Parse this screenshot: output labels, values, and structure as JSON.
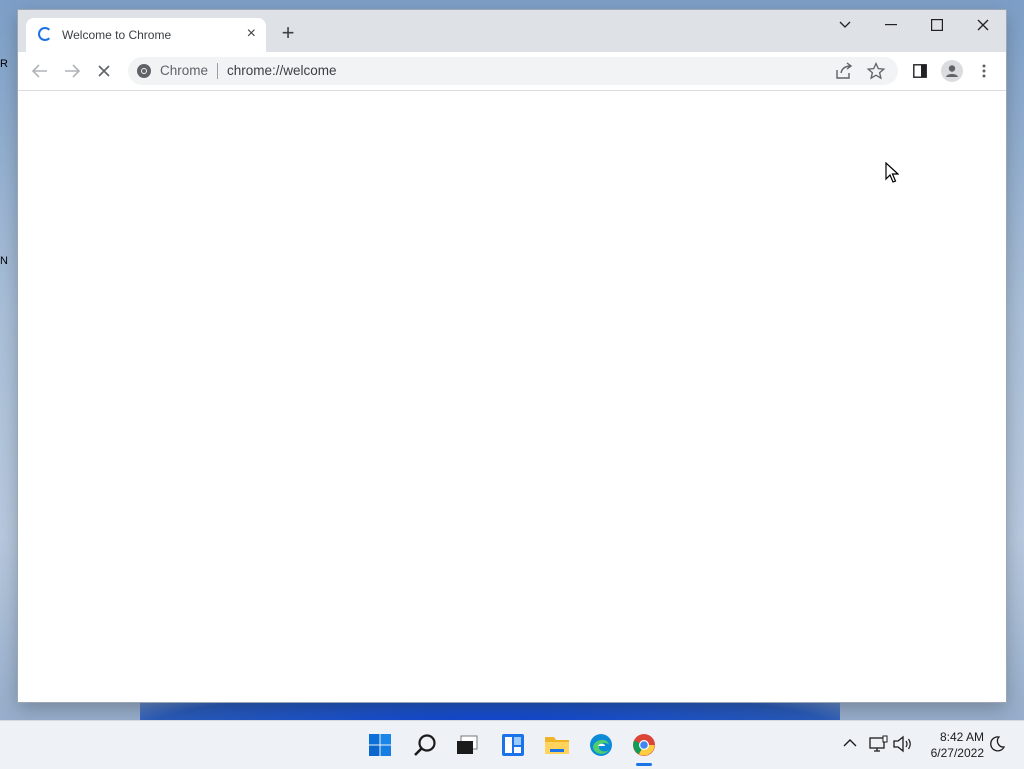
{
  "desktop": {
    "frag1": "R",
    "frag2": "N"
  },
  "browser": {
    "tab": {
      "title": "Welcome to Chrome",
      "close_label": "×"
    },
    "newtab_label": "+",
    "omnibox": {
      "chip_label": "Chrome",
      "url": "chrome://welcome"
    }
  },
  "taskbar": {
    "icons": [
      "start-icon",
      "search-icon",
      "task-view-icon",
      "widgets-icon",
      "file-explorer-icon",
      "edge-icon",
      "chrome-icon"
    ],
    "clock": {
      "time": "8:42 AM",
      "date": "6/27/2022"
    }
  },
  "colors": {
    "accent": "#1a73e8",
    "tabstrip": "#dee1e6",
    "omnibox": "#f1f3f4",
    "taskbar": "#eef1f6"
  }
}
